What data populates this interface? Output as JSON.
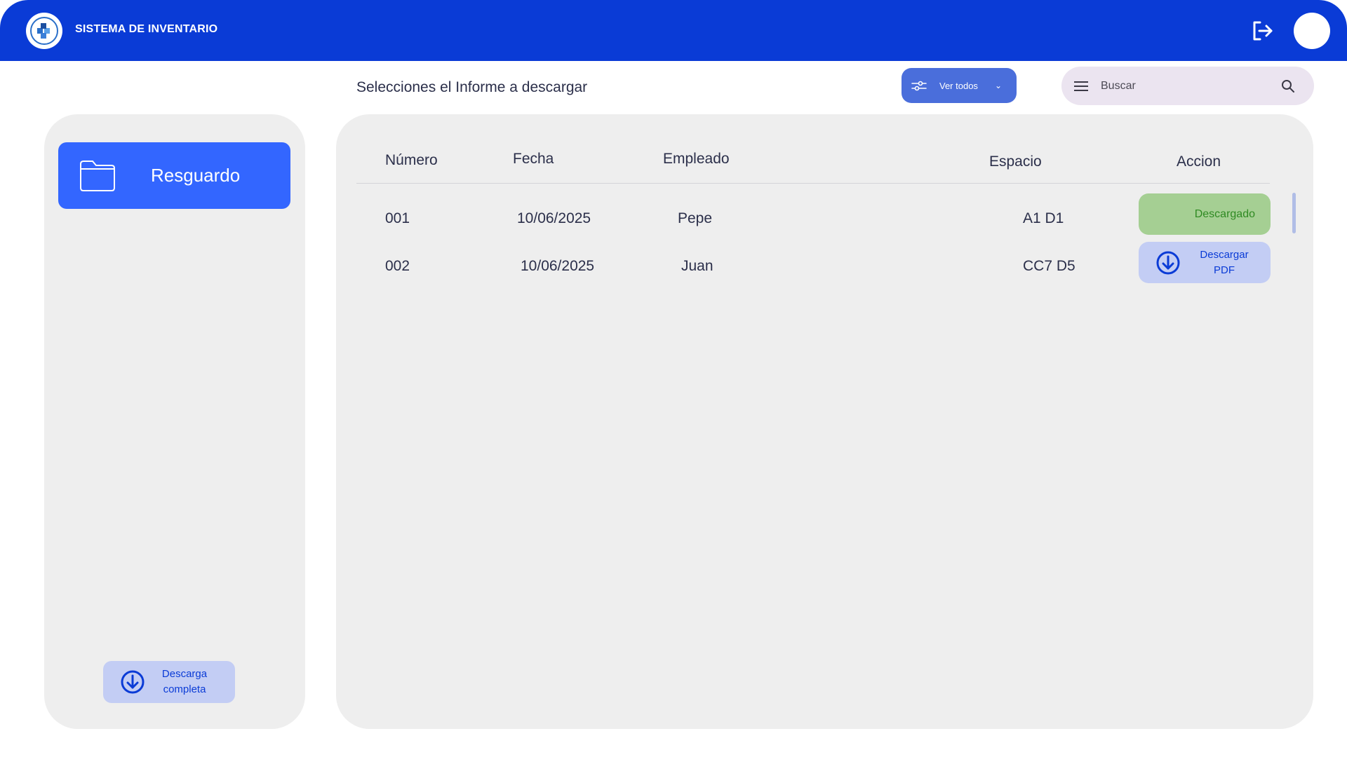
{
  "header": {
    "app_title": "SISTEMA DE INVENTARIO",
    "logo_icon": "inventory-logo-icon",
    "logout_icon": "logout-icon",
    "avatar_icon": "user-avatar"
  },
  "toolbar": {
    "page_title": "Selecciones el Informe a descargar",
    "filter": {
      "label": "Ver todos",
      "icon": "filter-icon",
      "chevron": "chevron-down-icon"
    },
    "search": {
      "placeholder": "Buscar",
      "value": "",
      "menu_icon": "menu-icon",
      "search_icon": "search-icon"
    }
  },
  "sidebar": {
    "category": {
      "label": "Resguardo",
      "icon": "folder-icon"
    },
    "full_download": {
      "line1": "Descarga",
      "line2": "completa",
      "icon": "download-circle-icon"
    }
  },
  "table": {
    "headers": {
      "numero": "Número",
      "fecha": "Fecha",
      "empleado": "Empleado",
      "espacio": "Espacio",
      "accion": "Accion"
    },
    "rows": [
      {
        "numero": "001",
        "fecha": "10/06/2025",
        "empleado": "Pepe",
        "espacio": "A1 D1",
        "accion": "Descargado",
        "accion_type": "downloaded"
      },
      {
        "numero": "002",
        "fecha": "10/06/2025",
        "empleado": "Juan",
        "espacio": "CC7 D5",
        "accion_line1": "Descargar",
        "accion_line2": "PDF",
        "accion_type": "download"
      }
    ]
  },
  "colors": {
    "brand_blue": "#0a3bd6",
    "category_blue": "#3366ff",
    "filter_blue": "#4a6edb",
    "panel_gray": "#eeeeee",
    "success_bg": "#a5cf93",
    "success_text": "#2f8a22",
    "download_bg": "#c3cdf4"
  }
}
